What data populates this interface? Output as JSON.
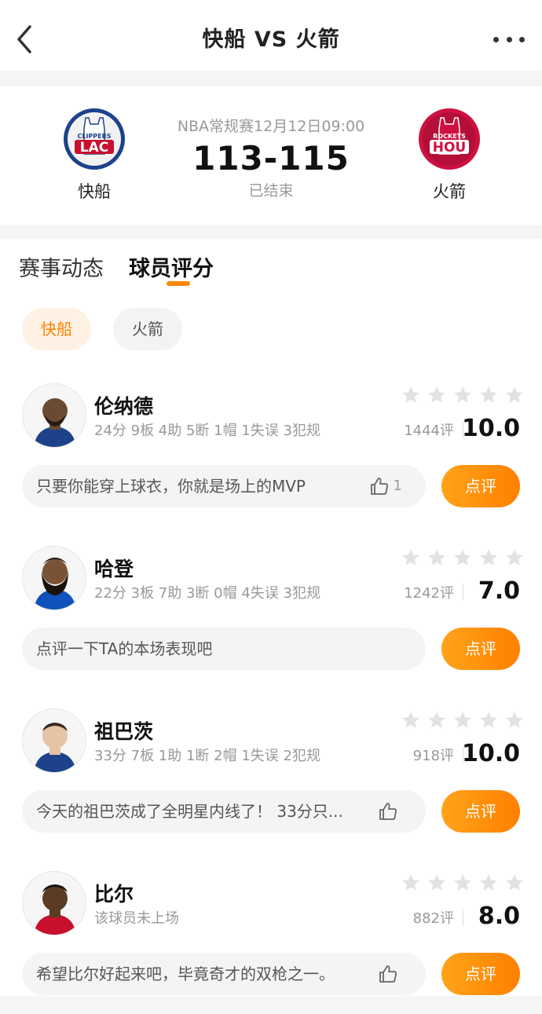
{
  "nav": {
    "title": "快船 VS 火箭"
  },
  "match": {
    "league_time": "NBA常规赛12月12日09:00",
    "score": "113-115",
    "status": "已结束",
    "home": {
      "name": "快船",
      "logo_text": "LAC",
      "logo_sub": "CLIPPERS",
      "color": "#1d428a"
    },
    "away": {
      "name": "火箭",
      "logo_text": "HOU",
      "logo_sub": "ROCKETS",
      "color": "#ce1141"
    }
  },
  "tabs": [
    {
      "label": "赛事动态",
      "active": false
    },
    {
      "label": "球员评分",
      "active": true
    }
  ],
  "team_filter": [
    {
      "label": "快船",
      "active": true
    },
    {
      "label": "火箭",
      "active": false
    }
  ],
  "players": [
    {
      "name": "伦纳德",
      "stats": "24分 9板 4助 5断 1帽 1失误 3犯规",
      "count": "1444评",
      "rating": "10.0",
      "comment": "只要你能穿上球衣，你就是场上的MVP",
      "likes": "1",
      "button": "点评"
    },
    {
      "name": "哈登",
      "stats": "22分 3板 7助 3断 0帽 4失误 3犯规",
      "count": "1242评",
      "rating": "7.0",
      "comment": "点评一下TA的本场表现吧",
      "likes": "",
      "button": "点评"
    },
    {
      "name": "祖巴茨",
      "stats": "33分 7板 1助 1断 2帽 1失误 2犯规",
      "count": "918评",
      "rating": "10.0",
      "comment": "今天的祖巴茨成了全明星内线了！ 33分只...",
      "likes": "",
      "button": "点评"
    },
    {
      "name": "比尔",
      "stats": "该球员未上场",
      "count": "882评",
      "rating": "8.0",
      "comment": "希望比尔好起来吧，毕竟奇才的双枪之一。",
      "likes": "",
      "button": "点评"
    }
  ],
  "colors": {
    "accent": "#ff8a00",
    "star_empty": "#e2e2e2"
  }
}
